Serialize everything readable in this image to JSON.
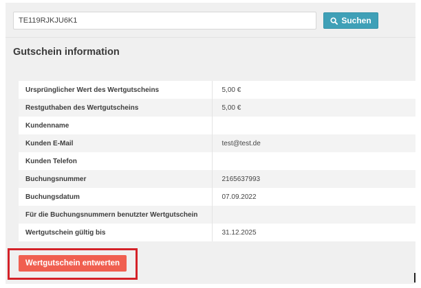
{
  "search": {
    "value": "TE119RJKJU6K1",
    "button_label": "Suchen",
    "button_icon": "search-icon"
  },
  "section": {
    "title": "Gutschein information"
  },
  "info_rows": [
    {
      "label": "Ursprünglicher Wert des Wertgutscheins",
      "value": "5,00 €"
    },
    {
      "label": "Restguthaben des Wertgutscheins",
      "value": "5,00 €"
    },
    {
      "label": "Kundenname",
      "value": ""
    },
    {
      "label": "Kunden E-Mail",
      "value": "test@test.de"
    },
    {
      "label": "Kunden Telefon",
      "value": ""
    },
    {
      "label": "Buchungsnummer",
      "value": "2165637993"
    },
    {
      "label": "Buchungsdatum",
      "value": "07.09.2022"
    },
    {
      "label": "Für die Buchungsnummern benutzter Wertgutschein",
      "value": ""
    },
    {
      "label": "Wertgutschein gültig bis",
      "value": "31.12.2025"
    }
  ],
  "actions": {
    "redeem_label": "Wertgutschein entwerten"
  },
  "colors": {
    "search_button": "#3fa0b7",
    "redeem_button": "#f05f50",
    "highlight_border": "#d42128",
    "panel_background": "#f0f0f0"
  }
}
